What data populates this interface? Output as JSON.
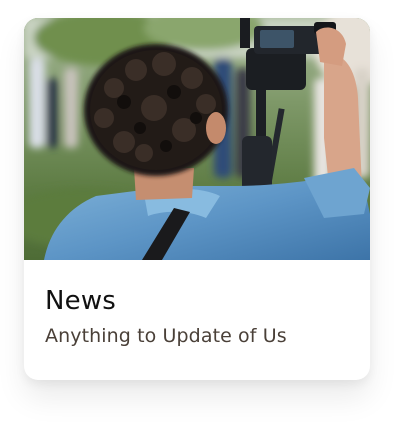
{
  "card": {
    "title": "News",
    "subtitle": "Anything to Update of Us",
    "image": "photo of a curly-haired man in a blue denim shirt operating a video camera at an outdoor event"
  }
}
